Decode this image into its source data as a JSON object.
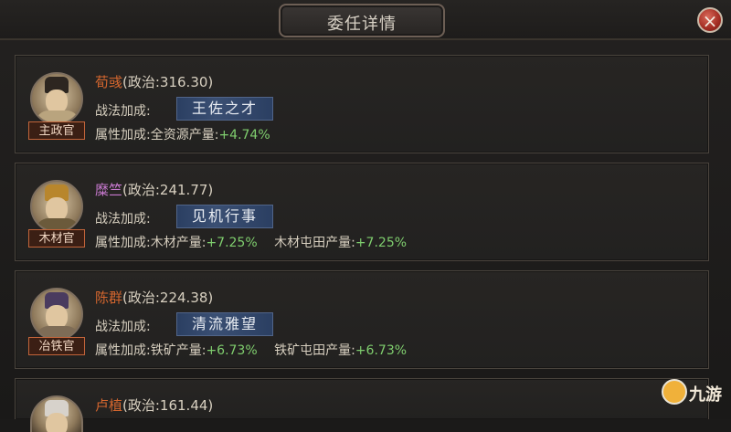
{
  "dialog": {
    "title": "委任详情",
    "close_icon": "×"
  },
  "officials": [
    {
      "name": "荀彧",
      "stat": "(政治:316.30)",
      "role": "主政官",
      "tactic_label": "战法加成:",
      "tactic": "王佐之才",
      "attr_label": "属性加成:",
      "attrs": [
        {
          "label": "全资源产量:",
          "value": "+4.74%"
        }
      ]
    },
    {
      "name": "糜竺",
      "stat": "(政治:241.77)",
      "role": "木材官",
      "tactic_label": "战法加成:",
      "tactic": "见机行事",
      "attr_label": "属性加成:",
      "attrs": [
        {
          "label": "木材产量:",
          "value": "+7.25%"
        },
        {
          "label": "木材屯田产量:",
          "value": "+7.25%"
        }
      ]
    },
    {
      "name": "陈群",
      "stat": "(政治:224.38)",
      "role": "冶铁官",
      "tactic_label": "战法加成:",
      "tactic": "清流雅望",
      "attr_label": "属性加成:",
      "attrs": [
        {
          "label": "铁矿产量:",
          "value": "+6.73%"
        },
        {
          "label": "铁矿屯田产量:",
          "value": "+6.73%"
        }
      ]
    },
    {
      "name": "卢植",
      "stat": "(政治:161.44)"
    }
  ],
  "watermark": {
    "text": "九游",
    "icon": "mascot-icon"
  },
  "colors": {
    "name_orange": "#d4662e",
    "name_purple": "#c97ad0",
    "value_green": "#7fce6e",
    "chip_blue": "#3a4f73"
  }
}
